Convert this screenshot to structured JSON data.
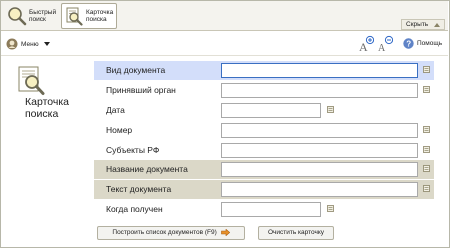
{
  "tabs": {
    "quick": {
      "label": "Быстрый поиск"
    },
    "card": {
      "label": "Карточка поиска"
    }
  },
  "hide_button": {
    "label": "Скрыть"
  },
  "toolbar": {
    "menu_label": "Меню",
    "help_label": "Помощь"
  },
  "panel": {
    "title": "Карточка поиска"
  },
  "form": {
    "fields": [
      {
        "label": "Вид документа",
        "value": ""
      },
      {
        "label": "Принявший орган",
        "value": ""
      },
      {
        "label": "Дата",
        "value": ""
      },
      {
        "label": "Номер",
        "value": ""
      },
      {
        "label": "Субъекты РФ",
        "value": ""
      },
      {
        "label": "Название документа",
        "value": ""
      },
      {
        "label": "Текст документа",
        "value": ""
      },
      {
        "label": "Когда получен",
        "value": ""
      }
    ]
  },
  "buttons": {
    "build": "Построить список документов (F9)",
    "clear": "Очистить карточку"
  },
  "colors": {
    "row_highlight_blue": "#d3defa",
    "row_highlight_grey": "#dbd8c8",
    "active_input_border": "#3a6fc2",
    "arrow_orange": "#e8912a"
  }
}
